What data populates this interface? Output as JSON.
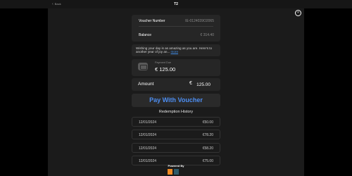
{
  "topbar": {
    "back_label": "Back",
    "title": "T2"
  },
  "voucher": {
    "number_label": "Voucher Number",
    "number_value": "IE-0124039O2065",
    "balance_label": "Balance",
    "balance_value": "€ 314.40"
  },
  "message": {
    "text": "Wishing your day is as amazing as you are. Here's to another year of joy an...",
    "more_label": "more"
  },
  "payment": {
    "label": "Payment Due",
    "value": "€ 125.00"
  },
  "amount": {
    "label": "Amount",
    "currency": "€",
    "value": "125.00"
  },
  "pay_button_label": "Pay With Voucher",
  "history": {
    "title": "Redemption History",
    "rows": [
      {
        "date": "12/01/2024",
        "amount": "€50.00"
      },
      {
        "date": "12/01/2024",
        "amount": "€78.20"
      },
      {
        "date": "12/01/2024",
        "amount": "€58.20"
      },
      {
        "date": "12/01/2024",
        "amount": "€75.00"
      }
    ]
  },
  "footer": {
    "powered_label": "Powered By"
  },
  "colors": {
    "accent": "#4d8ef2",
    "brand_orange": "#f08a24",
    "brand_teal": "#2e5a6a"
  }
}
